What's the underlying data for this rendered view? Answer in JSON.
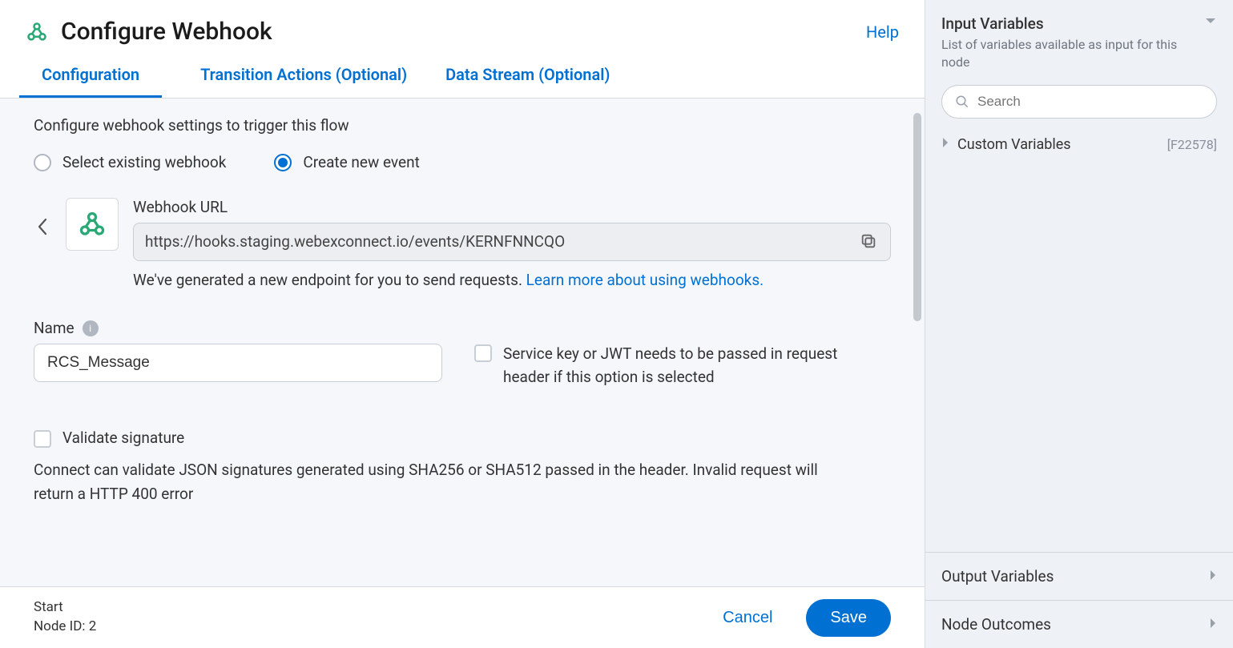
{
  "header": {
    "title": "Configure Webhook",
    "help": "Help"
  },
  "tabs": [
    {
      "label": "Configuration",
      "active": true
    },
    {
      "label": "Transition Actions (Optional)",
      "active": false
    },
    {
      "label": "Data Stream (Optional)",
      "active": false
    }
  ],
  "config": {
    "intro": "Configure webhook settings to trigger this flow",
    "radios": {
      "existing": "Select existing webhook",
      "create": "Create new event"
    },
    "url_label": "Webhook URL",
    "url_value": "https://hooks.staging.webexconnect.io/events/KERNFNNCQO",
    "url_helper_pre": "We've generated a new endpoint for you to send requests. ",
    "url_helper_link": "Learn more about using webhooks.",
    "name_label": "Name",
    "name_value": "RCS_Message",
    "jwt_label": "Service key or JWT needs to be passed in request header if this option is selected",
    "validate_label": "Validate signature",
    "validate_desc": "Connect can validate JSON signatures generated using SHA256 or SHA512 passed in the header. Invalid request will return a HTTP 400 error"
  },
  "footer": {
    "meta_l1": "Start",
    "meta_l2": "Node ID: 2",
    "cancel": "Cancel",
    "save": "Save"
  },
  "side": {
    "input_title": "Input Variables",
    "input_sub": "List of variables available as input for this node",
    "search_placeholder": "Search",
    "custom_label": "Custom Variables",
    "custom_id": "[F22578]",
    "output_label": "Output Variables",
    "outcomes_label": "Node Outcomes"
  }
}
